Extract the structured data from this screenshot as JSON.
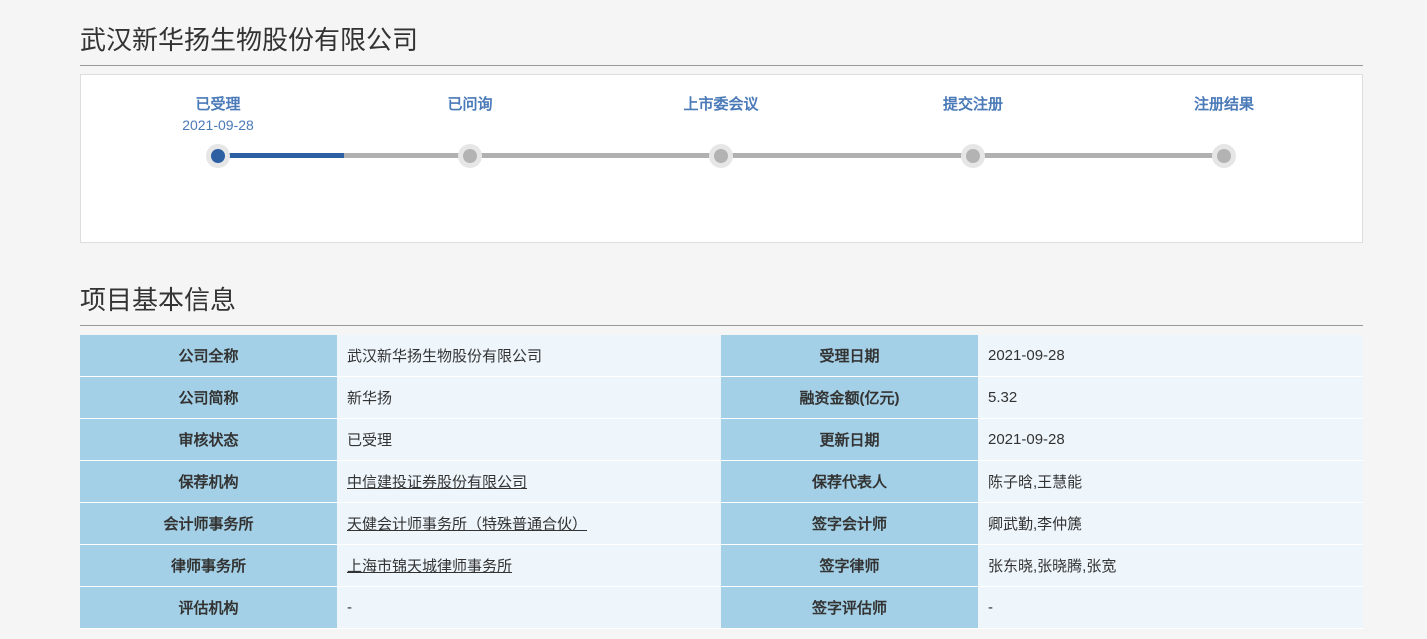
{
  "company_title": "武汉新华扬生物股份有限公司",
  "progress": {
    "steps": [
      {
        "label": "已受理",
        "date": "2021-09-28",
        "active": true
      },
      {
        "label": "已问询",
        "date": "",
        "active": false
      },
      {
        "label": "上市委会议",
        "date": "",
        "active": false
      },
      {
        "label": "提交注册",
        "date": "",
        "active": false
      },
      {
        "label": "注册结果",
        "date": "",
        "active": false
      }
    ],
    "colors": {
      "active": "#2d5fa3",
      "inactive": "#b3b3b3",
      "label": "#4a7ab8"
    }
  },
  "info_section_title": "项目基本信息",
  "info": {
    "rows": [
      {
        "l1": "公司全称",
        "v1": "武汉新华扬生物股份有限公司",
        "link1": false,
        "l2": "受理日期",
        "v2": "2021-09-28"
      },
      {
        "l1": "公司简称",
        "v1": "新华扬",
        "link1": false,
        "l2": "融资金额(亿元)",
        "v2": "5.32"
      },
      {
        "l1": "审核状态",
        "v1": "已受理",
        "link1": false,
        "l2": "更新日期",
        "v2": "2021-09-28"
      },
      {
        "l1": "保荐机构",
        "v1": "中信建投证券股份有限公司",
        "link1": true,
        "l2": "保荐代表人",
        "v2": "陈子晗,王慧能"
      },
      {
        "l1": "会计师事务所",
        "v1": "天健会计师事务所（特殊普通合伙）",
        "link1": true,
        "l2": "签字会计师",
        "v2": "卿武勤,李仲篪"
      },
      {
        "l1": "律师事务所",
        "v1": "上海市锦天城律师事务所",
        "link1": true,
        "l2": "签字律师",
        "v2": "张东晓,张晓腾,张宽"
      },
      {
        "l1": "评估机构",
        "v1": "-",
        "link1": false,
        "l2": "签字评估师",
        "v2": "-"
      }
    ],
    "colors": {
      "label_bg": "#a3d0e6",
      "value_bg": "#eef6fc"
    }
  }
}
